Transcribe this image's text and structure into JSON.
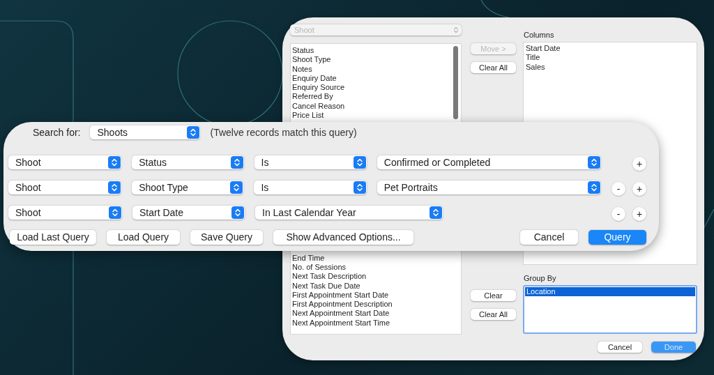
{
  "fields_dialog": {
    "table_dropdown": {
      "value": "Shoot",
      "disabled": true
    },
    "fields_list": {
      "items_top": [
        "Status",
        "Shoot Type",
        "Notes",
        "Enquiry Date",
        "Enquiry Source",
        "Referred By",
        "Cancel Reason",
        "Price List"
      ],
      "items_bottom": [
        "End Time",
        "No. of Sessions",
        "Next Task Description",
        "Next Task Due Date",
        "First Appointment Start Date",
        "First Appointment Description",
        "Next Appointment Start Date",
        "Next Appointment Start Time"
      ]
    },
    "column_buttons": [
      {
        "label": "Move >",
        "disabled": true
      },
      {
        "label": "Clear All",
        "disabled": false
      }
    ],
    "group_buttons": [
      {
        "label": "Clear",
        "disabled": false
      },
      {
        "label": "Clear All",
        "disabled": false
      }
    ],
    "columns": {
      "label": "Columns",
      "items": [
        "Start Date",
        "Title",
        "Sales"
      ]
    },
    "group_by": {
      "label": "Group By",
      "items": [
        {
          "label": "Location",
          "selected": true
        }
      ]
    },
    "footer_buttons": [
      {
        "label": "Cancel",
        "kind": "default"
      },
      {
        "label": "Done",
        "kind": "primary"
      }
    ]
  },
  "query_dialog": {
    "search_for": {
      "label": "Search for:",
      "value": "Shoots"
    },
    "match_note": "(Twelve records match this query)",
    "conditions": [
      {
        "table": "Shoot",
        "field": "Status",
        "operator": "Is",
        "value": "Confirmed or Completed",
        "buttons": [
          "+"
        ]
      },
      {
        "table": "Shoot",
        "field": "Shoot Type",
        "operator": "Is",
        "value": "Pet Portraits",
        "buttons": [
          "-",
          "+"
        ]
      },
      {
        "table": "Shoot",
        "field": "Start Date",
        "operator": "In Last Calendar Year",
        "buttons": [
          "-",
          "+"
        ]
      }
    ],
    "left_buttons": [
      "Load Last Query",
      "Load Query",
      "Save Query",
      "Show Advanced Options..."
    ],
    "right_buttons": [
      {
        "label": "Cancel",
        "kind": "default"
      },
      {
        "label": "Query",
        "kind": "primary"
      }
    ]
  }
}
